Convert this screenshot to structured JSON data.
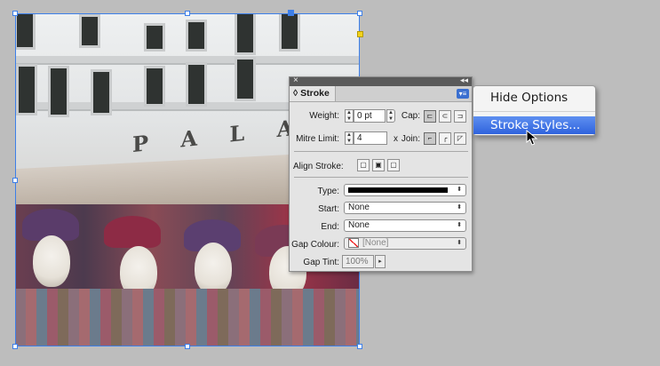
{
  "panel": {
    "tab_label": "Stroke",
    "close_glyph": "×",
    "collapse_glyph": "◂◂",
    "menu_glyph": "▾≡",
    "weight": {
      "label": "Weight:",
      "value": "0 pt"
    },
    "cap": {
      "label": "Cap:",
      "icons": [
        "butt-cap-icon",
        "round-cap-icon",
        "projecting-cap-icon"
      ]
    },
    "mitre_limit": {
      "label": "Mitre Limit:",
      "value": "4",
      "unit": "x"
    },
    "join": {
      "label": "Join:",
      "icons": [
        "miter-join-icon",
        "round-join-icon",
        "bevel-join-icon"
      ]
    },
    "align_stroke": {
      "label": "Align Stroke:",
      "icons": [
        "align-center-icon",
        "align-inside-icon",
        "align-outside-icon"
      ]
    },
    "type": {
      "label": "Type:"
    },
    "start": {
      "label": "Start:",
      "value": "None"
    },
    "end": {
      "label": "End:",
      "value": "None"
    },
    "gap_colour": {
      "label": "Gap Colour:",
      "value": "[None]"
    },
    "gap_tint": {
      "label": "Gap Tint:",
      "value": "100%"
    }
  },
  "menu": {
    "items": [
      {
        "label": "Hide Options"
      },
      {
        "label": "Stroke Styles..."
      }
    ]
  },
  "photo": {
    "sign_text": "P A L A C"
  },
  "colors": {
    "selection": "#3d7fe8",
    "menu_highlight": "#2f63dd"
  }
}
